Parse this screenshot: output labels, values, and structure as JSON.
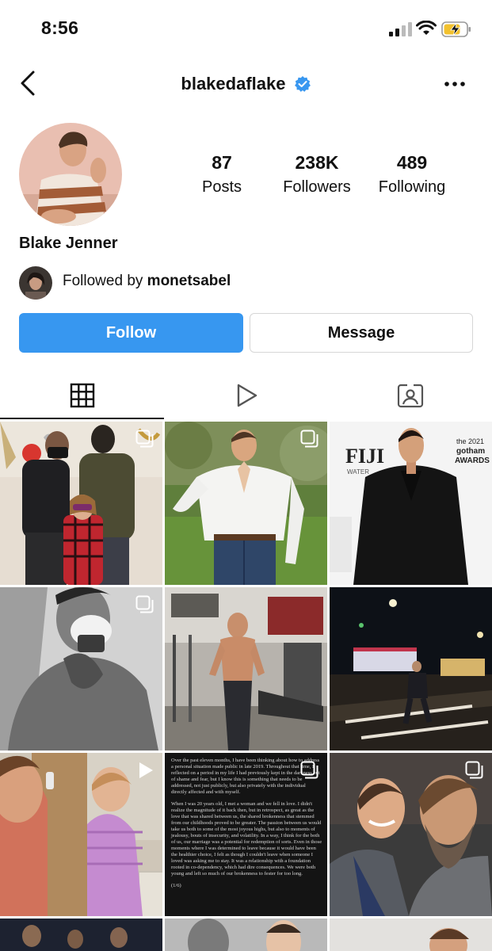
{
  "status_bar": {
    "time": "8:56"
  },
  "header": {
    "username": "blakedaflake"
  },
  "profile": {
    "display_name": "Blake Jenner",
    "stats": [
      {
        "value": "87",
        "label": "Posts"
      },
      {
        "value": "238K",
        "label": "Followers"
      },
      {
        "value": "489",
        "label": "Following"
      }
    ],
    "followed_by_prefix": "Followed by",
    "followed_by_user": "monetsabel"
  },
  "actions": {
    "follow_label": "Follow",
    "message_label": "Message"
  },
  "tabs": [
    {
      "icon": "grid-icon",
      "selected": true
    },
    {
      "icon": "reels-play-icon",
      "selected": false
    },
    {
      "icon": "tagged-person-icon",
      "selected": false
    }
  ],
  "posts": [
    {
      "badge": "carousel"
    },
    {
      "badge": "carousel"
    },
    {
      "badge": "none",
      "sign_texts": [
        "FIJI",
        "WATER",
        "the 2021",
        "gotham",
        "AWARDS"
      ]
    },
    {
      "badge": "carousel"
    },
    {
      "badge": "none"
    },
    {
      "badge": "none"
    },
    {
      "badge": "video"
    },
    {
      "badge": "carousel",
      "text_paragraphs": [
        "Over the past eleven months, I have been thinking about how to address a personal situation made public in late 2019. Throughout that time, I reflected on a period in my life I had previously kept in the darkness out of shame and fear, but I know this is something that needs to be addressed, not just publicly, but also privately with the individual directly affected and with myself.",
        "When I was 20 years old, I met a woman and we fell in love. I didn't realize the magnitude of it back then, but in retrospect, as great as the love that was shared between us, the shared brokenness that stemmed from our childhoods proved to be greater. The passion between us would take us both to some of the most joyous highs, but also to moments of jealousy, bouts of insecurity, and volatility. In a way, I think for the both of us, our marriage was a potential for redemption of sorts. Even in those moments where I was determined to leave because it would have been the healthier choice, I felt as though I couldn't leave when someone I loved was asking me to stay. It was a relationship with a foundation rooted in co-dependency, which had dire consequences. We were both young and left so much of our brokenness to fester for too long.",
        "(1/6)"
      ]
    },
    {
      "badge": "carousel"
    }
  ]
}
